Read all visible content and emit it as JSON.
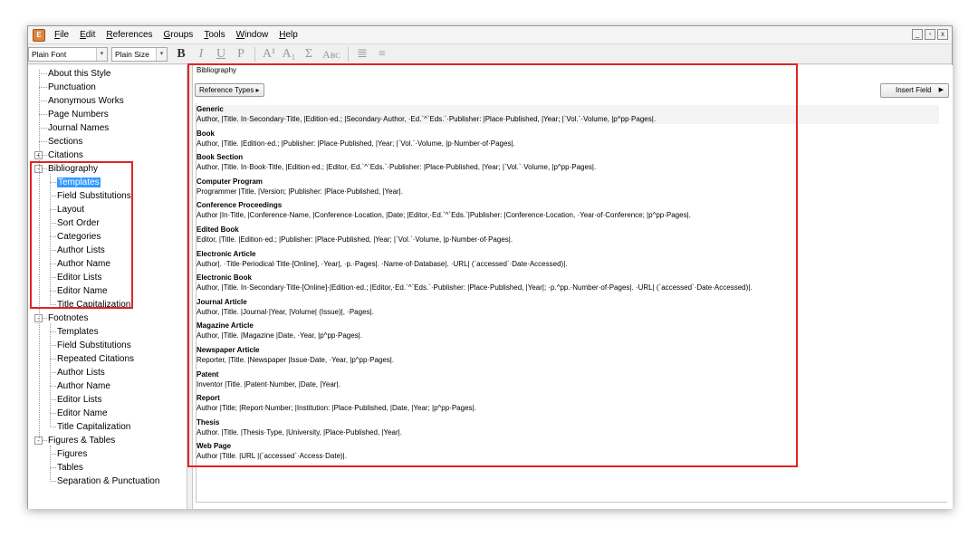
{
  "menu": [
    "File",
    "Edit",
    "References",
    "Groups",
    "Tools",
    "Window",
    "Help"
  ],
  "window_controls": [
    "_",
    "▫",
    "x"
  ],
  "toolbar": {
    "font": "Plain Font",
    "size": "Plain Size",
    "buttons": [
      "B",
      "I",
      "U",
      "P",
      "A¹",
      "A₁",
      "Σ",
      "Aʙᴄ",
      "≣",
      "≡"
    ]
  },
  "tree": {
    "items": [
      {
        "label": "About this Style",
        "level": 0
      },
      {
        "label": "Punctuation",
        "level": 0
      },
      {
        "label": "Anonymous Works",
        "level": 0
      },
      {
        "label": "Page Numbers",
        "level": 0
      },
      {
        "label": "Journal Names",
        "level": 0
      },
      {
        "label": "Sections",
        "level": 0
      },
      {
        "label": "Citations",
        "level": 0,
        "expander": "+"
      },
      {
        "label": "Bibliography",
        "level": 0,
        "expander": "-"
      },
      {
        "label": "Templates",
        "level": 1,
        "selected": true
      },
      {
        "label": "Field Substitutions",
        "level": 1
      },
      {
        "label": "Layout",
        "level": 1
      },
      {
        "label": "Sort Order",
        "level": 1
      },
      {
        "label": "Categories",
        "level": 1
      },
      {
        "label": "Author Lists",
        "level": 1
      },
      {
        "label": "Author Name",
        "level": 1
      },
      {
        "label": "Editor Lists",
        "level": 1
      },
      {
        "label": "Editor Name",
        "level": 1
      },
      {
        "label": "Title Capitalization",
        "level": 1
      },
      {
        "label": "Footnotes",
        "level": 0,
        "expander": "-"
      },
      {
        "label": "Templates",
        "level": 1
      },
      {
        "label": "Field Substitutions",
        "level": 1
      },
      {
        "label": "Repeated Citations",
        "level": 1
      },
      {
        "label": "Author Lists",
        "level": 1
      },
      {
        "label": "Author Name",
        "level": 1
      },
      {
        "label": "Editor Lists",
        "level": 1
      },
      {
        "label": "Editor Name",
        "level": 1
      },
      {
        "label": "Title Capitalization",
        "level": 1
      },
      {
        "label": "Figures & Tables",
        "level": 0,
        "expander": "-"
      },
      {
        "label": "Figures",
        "level": 1
      },
      {
        "label": "Tables",
        "level": 1
      },
      {
        "label": "Separation & Punctuation",
        "level": 1
      }
    ]
  },
  "panel": {
    "title": "Bibliography",
    "reference_types_button": "Reference Types ▸",
    "insert_field_button": "Insert Field"
  },
  "templates": [
    {
      "type": "Generic",
      "template": "Author, |Title. In·Secondary·Title, |Edition·ed.; |Secondary·Author, ·Ed.`^`Eds.`·Publisher: |Place·Published, |Year; |`Vol.`·Volume, |p^pp·Pages|."
    },
    {
      "type": "Book",
      "template": "Author, |Title. |Edition·ed.; |Publisher: |Place·Published, |Year; |`Vol.`·Volume, |p·Number·of·Pages|."
    },
    {
      "type": "Book Section",
      "template": "Author, |Title. In·Book·Title, |Edition·ed.; |Editor,·Ed.`^`Eds.`·Publisher: |Place·Published, |Year; |`Vol.`·Volume, |p^pp·Pages|."
    },
    {
      "type": "Computer Program",
      "template": "Programmer |Title, |Version; |Publisher: |Place·Published, |Year|."
    },
    {
      "type": "Conference Proceedings",
      "template": "Author |In·Title, |Conference·Name, |Conference·Location, |Date; |Editor,·Ed.`^`Eds.`|Publisher: |Conference·Location, ·Year·of·Conference; |p^pp·Pages|."
    },
    {
      "type": "Edited Book",
      "template": "Editor, |Title. |Edition·ed.; |Publisher: |Place·Published, |Year; |`Vol.`·Volume, |p·Number·of·Pages|."
    },
    {
      "type": "Electronic Article",
      "template": "Author|. ·Title·Periodical·Title·[Online], ·Year|, ·p.·Pages|. ·Name·of·Database|. ·URL| (`accessed`·Date·Accessed)|."
    },
    {
      "type": "Electronic Book",
      "template": "Author, |Title. In·Secondary·Title·[Online]·|Edition·ed.; |Editor,·Ed.`^`Eds.`·Publisher: |Place·Published, |Year|; ·p.^pp.·Number·of·Pages|. ·URL| (`accessed`·Date·Accessed)|."
    },
    {
      "type": "Journal Article",
      "template": "Author, |Title. |Journal·|Year, |Volume| (Issue)|, ·Pages|."
    },
    {
      "type": "Magazine Article",
      "template": "Author, |Title. |Magazine |Date, ·Year, |p^pp·Pages|."
    },
    {
      "type": "Newspaper Article",
      "template": "Reporter, |Title. |Newspaper |Issue·Date, ·Year, |p^pp·Pages|."
    },
    {
      "type": "Patent",
      "template": "Inventor |Title. |Patent·Number, |Date, |Year|."
    },
    {
      "type": "Report",
      "template": "Author |Title; |Report·Number; |Institution: |Place·Published, |Date, |Year; |p^pp·Pages|."
    },
    {
      "type": "Thesis",
      "template": "Author. |Title. |Thesis·Type, |University, |Place·Published, |Year|."
    },
    {
      "type": "Web Page",
      "template": "Author |Title. |URL |(`accessed`·Access·Date)|."
    }
  ],
  "colors": {
    "highlight_box": "#e02424",
    "selection": "#3399ff"
  }
}
